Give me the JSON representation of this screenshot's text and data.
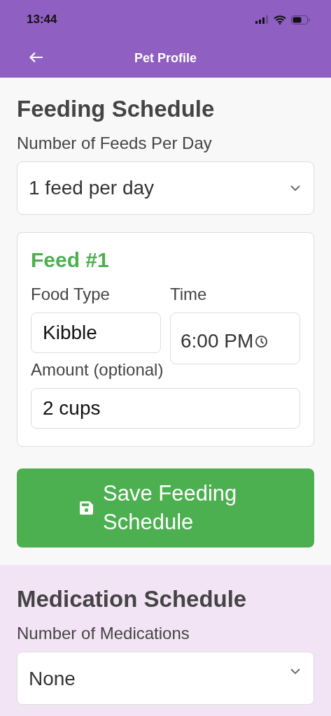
{
  "status_bar": {
    "time": "13:44"
  },
  "header": {
    "title": "Pet Profile"
  },
  "feeding": {
    "title": "Feeding Schedule",
    "feeds_label": "Number of Feeds Per Day",
    "feeds_value": "1 feed per day",
    "feeds": [
      {
        "title": "Feed #1",
        "food_label": "Food Type",
        "food_value": "Kibble",
        "time_label": "Time",
        "time_value": "6:00 PM",
        "amount_label": "Amount (optional)",
        "amount_value": "2 cups"
      }
    ],
    "save_button": "Save Feeding Schedule"
  },
  "medication": {
    "title": "Medication Schedule",
    "count_label": "Number of Medications",
    "count_value": "None"
  }
}
